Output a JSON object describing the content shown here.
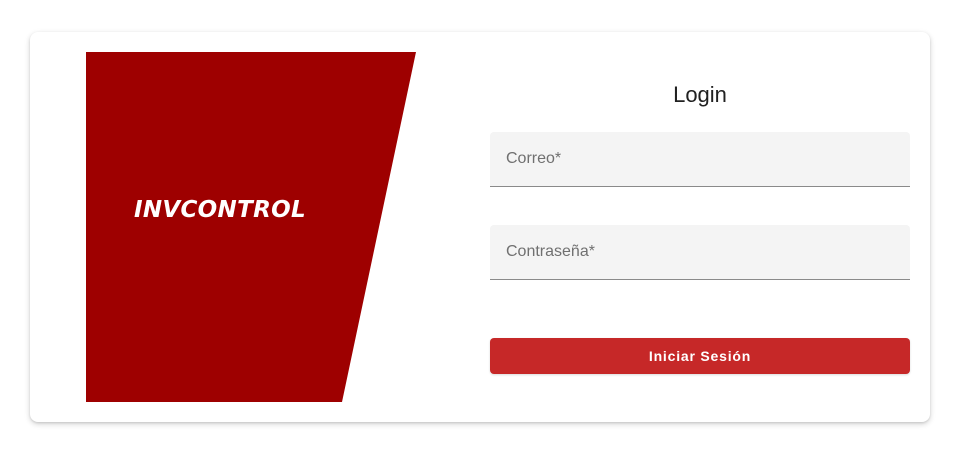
{
  "brand": {
    "name": "INVCONTROL",
    "panel_color": "#9e0000"
  },
  "login": {
    "title": "Login",
    "email_placeholder": "Correo*",
    "email_value": "",
    "password_placeholder": "Contraseña*",
    "password_value": "",
    "submit_label": "Iniciar Sesión",
    "accent_color": "#c62828"
  }
}
